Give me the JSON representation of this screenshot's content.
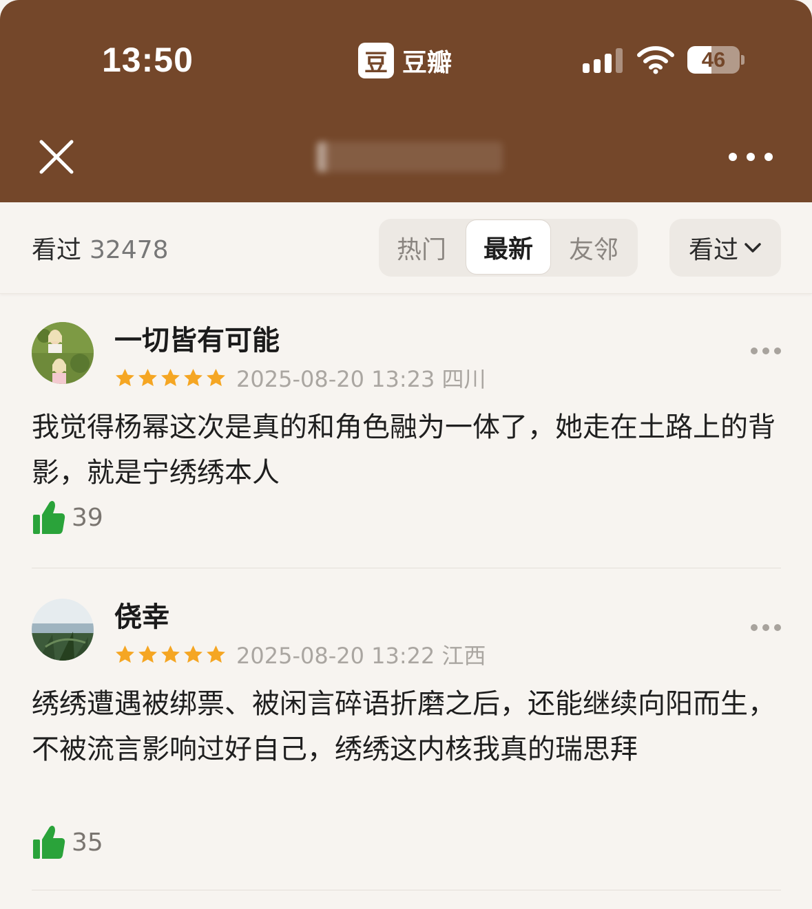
{
  "status_bar": {
    "time": "13:50",
    "battery": "46",
    "battery_level": 0.46
  },
  "app": {
    "logo_glyph": "豆",
    "name": "豆瓣"
  },
  "nav": {
    "title": ""
  },
  "filter": {
    "label": "看过",
    "count": "32478",
    "tabs": [
      "热门",
      "最新",
      "友邻"
    ],
    "active_tab": "最新",
    "dropdown_label": "看过"
  },
  "reviews": [
    {
      "username": "一切皆有可能",
      "rating": 5,
      "datetime": "2025-08-20 13:23",
      "location": "四川",
      "meta": "2025-08-20 13:23 四川",
      "text": "我觉得杨幂这次是真的和角色融为一体了，她走在土路上的背影，就是宁绣绣本人",
      "likes": "39"
    },
    {
      "username": "侥幸",
      "rating": 5,
      "datetime": "2025-08-20 13:22",
      "location": "江西",
      "meta": "2025-08-20 13:22 江西",
      "text": "绣绣遭遇被绑票、被闲言碎语折磨之后，还能继续向阳而生，不被流言影响过好自己，绣绣这内核我真的瑞思拜",
      "likes": "35"
    }
  ],
  "colors": {
    "header_bg": "#74472a",
    "star": "#f5a623",
    "like_green": "#2aa33a",
    "page_bg": "#f7f4f0"
  },
  "icons": {
    "close": "close-icon",
    "more": "more-icon",
    "star": "star-icon",
    "like": "thumbs-up-icon",
    "chevron": "chevron-down-icon"
  }
}
